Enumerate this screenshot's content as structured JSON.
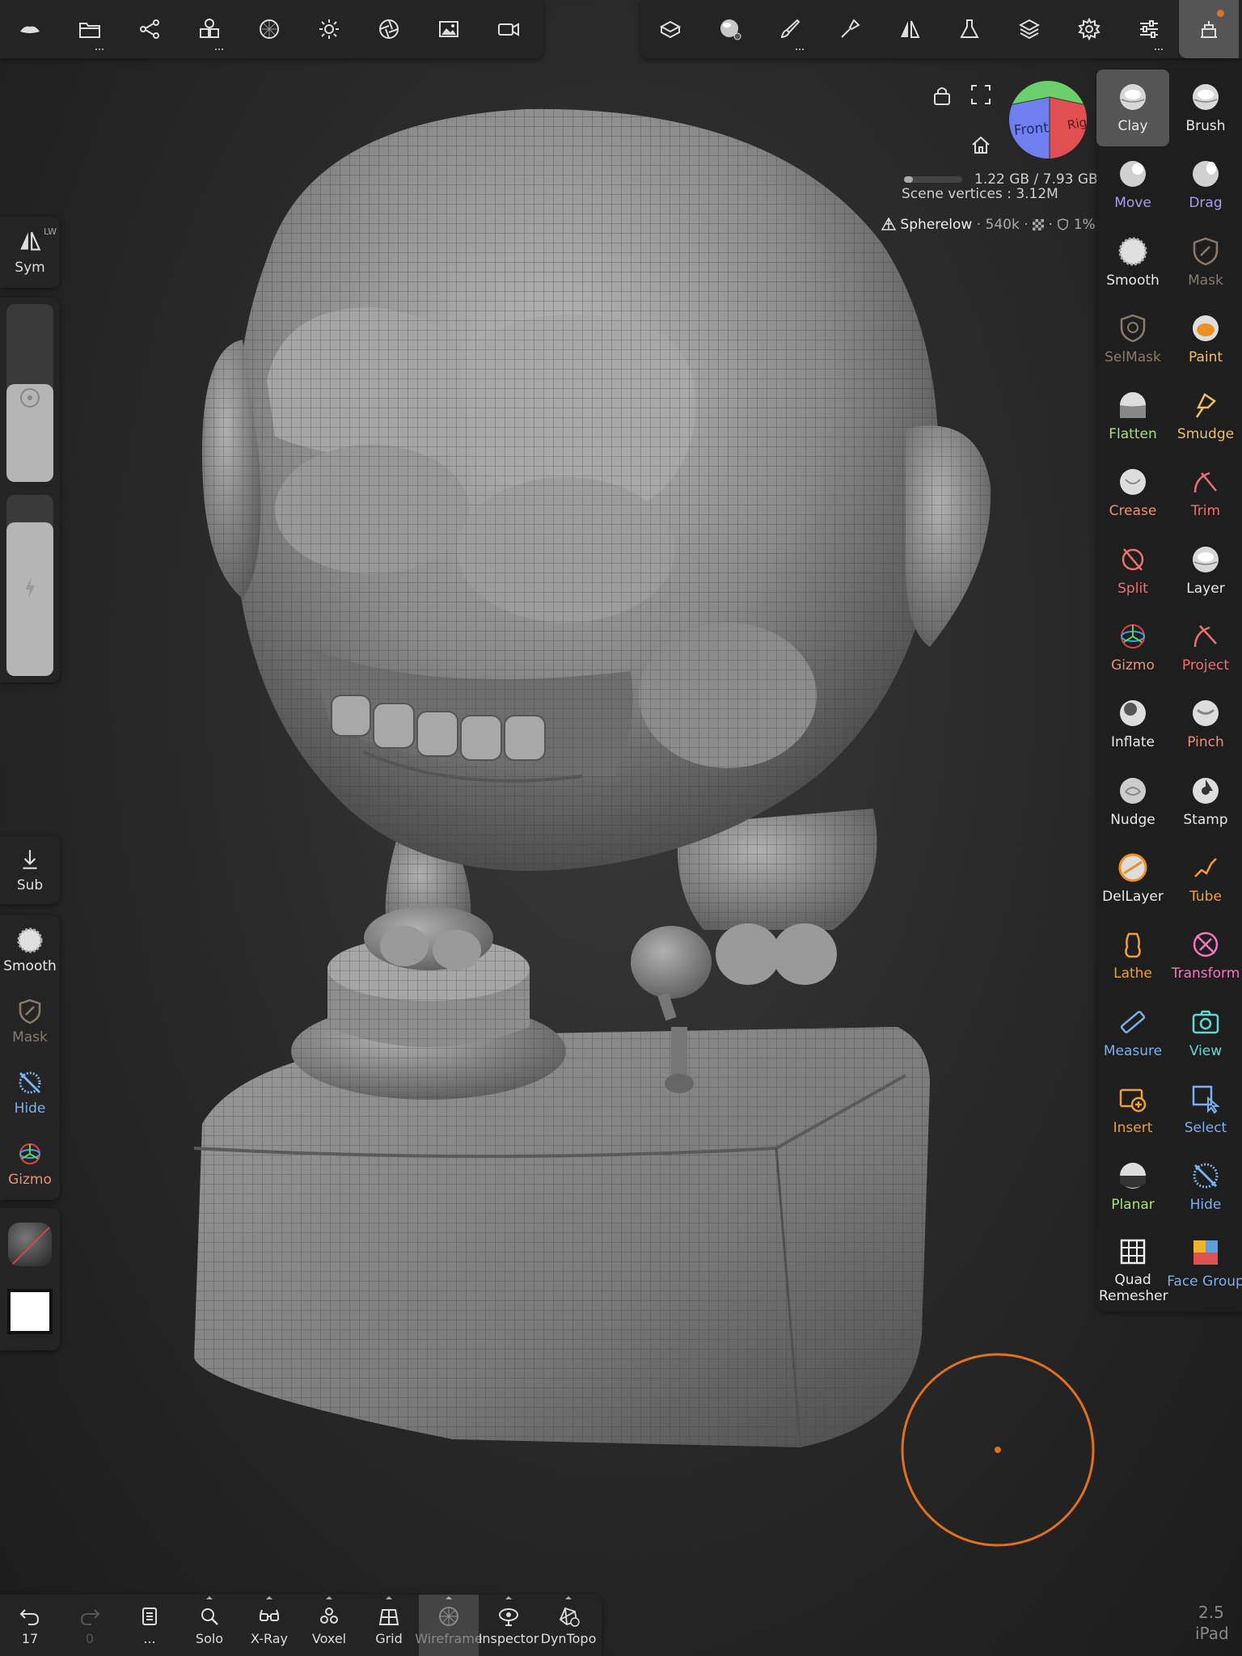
{
  "top_left_toolbar": {
    "icons": [
      "nomad-logo-icon",
      "folder-icon",
      "scene-tree-icon",
      "primitives-icon",
      "material-sphere-icon",
      "light-icon",
      "camera-aperture-icon",
      "image-icon",
      "video-icon"
    ]
  },
  "top_right_toolbar": {
    "icons": [
      "topology-icon",
      "material-preview-icon",
      "paint-brush-icon",
      "stamp-tool-icon",
      "symmetry-icon",
      "flask-icon",
      "layers-icon",
      "settings-gear-icon",
      "sliders-icon",
      "scene-pin-icon"
    ]
  },
  "viewport": {
    "memory": "1.22 GB / 7.93 GB",
    "scene_vertices": "Scene vertices : 3.12M",
    "mesh_name": "Spherelow",
    "mesh_vertices": "540k",
    "mesh_percent": "1%",
    "view_cube_front": "Front",
    "view_cube_right": "Rig"
  },
  "brushes": [
    {
      "name": "Clay",
      "color": "#e8e8e8",
      "icon": "clay-icon",
      "active": true
    },
    {
      "name": "Brush",
      "color": "#e8e8e8",
      "icon": "brush-icon"
    },
    {
      "name": "Move",
      "color": "#a99cf0",
      "icon": "move-icon"
    },
    {
      "name": "Drag",
      "color": "#a99cf0",
      "icon": "drag-icon"
    },
    {
      "name": "Smooth",
      "color": "#e8e8e8",
      "icon": "smooth-icon"
    },
    {
      "name": "Mask",
      "color": "#8a7a68",
      "icon": "mask-icon"
    },
    {
      "name": "SelMask",
      "color": "#8a7a68",
      "icon": "selmask-icon"
    },
    {
      "name": "Paint",
      "color": "#f0c060",
      "icon": "paint-icon"
    },
    {
      "name": "Flatten",
      "color": "#a6e07a",
      "icon": "flatten-icon"
    },
    {
      "name": "Smudge",
      "color": "#f0c060",
      "icon": "smudge-icon"
    },
    {
      "name": "Crease",
      "color": "#f08f6f",
      "icon": "crease-icon"
    },
    {
      "name": "Trim",
      "color": "#f06f6f",
      "icon": "trim-icon"
    },
    {
      "name": "Split",
      "color": "#f06f6f",
      "icon": "split-icon"
    },
    {
      "name": "Layer",
      "color": "#e8e8e8",
      "icon": "layer-icon"
    },
    {
      "name": "Gizmo",
      "color": "#f08f6f",
      "icon": "gizmo-icon"
    },
    {
      "name": "Project",
      "color": "#f06f6f",
      "icon": "project-icon"
    },
    {
      "name": "Inflate",
      "color": "#e8e8e8",
      "icon": "inflate-icon"
    },
    {
      "name": "Pinch",
      "color": "#f08f6f",
      "icon": "pinch-icon"
    },
    {
      "name": "Nudge",
      "color": "#e8e8e8",
      "icon": "nudge-icon"
    },
    {
      "name": "Stamp",
      "color": "#e8e8e8",
      "icon": "stamp-icon"
    },
    {
      "name": "DelLayer",
      "color": "#e8e8e8",
      "icon": "dellayer-icon"
    },
    {
      "name": "Tube",
      "color": "#f0a030",
      "icon": "tube-icon"
    },
    {
      "name": "Lathe",
      "color": "#f0a030",
      "icon": "lathe-icon"
    },
    {
      "name": "Transform",
      "color": "#f078c0",
      "icon": "transform-icon"
    },
    {
      "name": "Measure",
      "color": "#7ab0f0",
      "icon": "measure-icon"
    },
    {
      "name": "View",
      "color": "#60d8d0",
      "icon": "view-camera-icon"
    },
    {
      "name": "Insert",
      "color": "#f0a030",
      "icon": "insert-icon"
    },
    {
      "name": "Select",
      "color": "#7ab0f0",
      "icon": "select-icon"
    },
    {
      "name": "Planar",
      "color": "#a6e07a",
      "icon": "planar-icon"
    },
    {
      "name": "Hide",
      "color": "#7ab0f0",
      "icon": "hide-icon"
    },
    {
      "name": "Quad Remesher",
      "color": "#e8e8e8",
      "icon": "quad-remesher-icon"
    },
    {
      "name": "Face Group",
      "color": "#7ab0f0",
      "icon": "face-group-icon"
    }
  ],
  "left_panel": {
    "sym_label": "Sym",
    "sym_tag": "LW",
    "sub_label": "Sub",
    "quick_tools": [
      {
        "name": "Smooth",
        "color": "#e8e8e8"
      },
      {
        "name": "Mask",
        "color": "#8a7a68"
      },
      {
        "name": "Hide",
        "color": "#7ab0f0"
      },
      {
        "name": "Gizmo",
        "color": "#f08f6f"
      }
    ],
    "radius_value": 0.55,
    "intensity_value": 1.0
  },
  "bottom_bar": {
    "undo_count": "17",
    "redo_count": "0",
    "menu_more": "...",
    "items": [
      {
        "label": "Solo",
        "icon": "solo-search-icon"
      },
      {
        "label": "X-Ray",
        "icon": "xray-glasses-icon"
      },
      {
        "label": "Voxel",
        "icon": "voxel-icon"
      },
      {
        "label": "Grid",
        "icon": "grid-icon"
      },
      {
        "label": "Wireframe",
        "icon": "wireframe-icon",
        "active": true
      },
      {
        "label": "Inspector",
        "icon": "inspector-icon"
      },
      {
        "label": "DynTopo",
        "icon": "dyntopo-icon"
      }
    ]
  },
  "version": {
    "number": "2.5",
    "platform": "iPad"
  },
  "colors": {
    "accent_orange": "#e07020",
    "panel_bg": "#242424"
  }
}
